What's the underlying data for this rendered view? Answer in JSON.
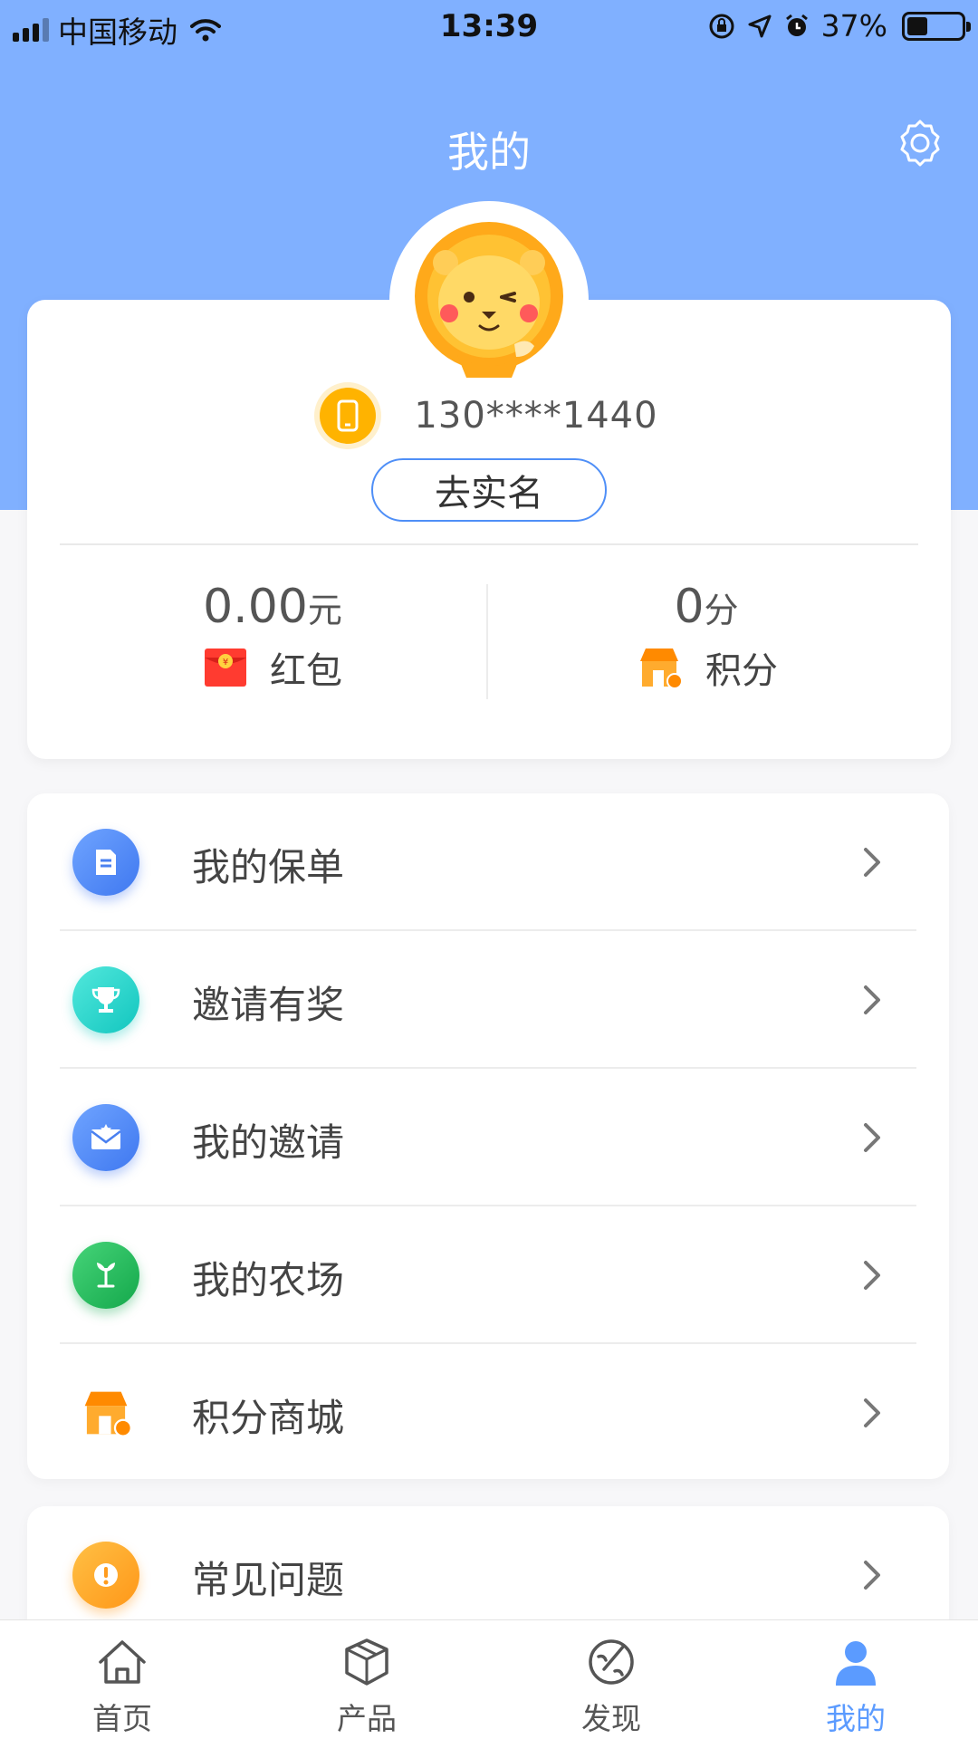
{
  "status_bar": {
    "carrier": "中国移动",
    "time": "13:39",
    "battery": "37%"
  },
  "header": {
    "title": "我的"
  },
  "profile": {
    "phone": "130****1440",
    "realname_button": "去实名",
    "red_packet": {
      "value": "0.00",
      "unit": "元",
      "label": "红包"
    },
    "points": {
      "value": "0",
      "unit": "分",
      "label": "积分"
    }
  },
  "menu": {
    "items": [
      {
        "label": "我的保单",
        "icon": "policy-icon"
      },
      {
        "label": "邀请有奖",
        "icon": "trophy-icon"
      },
      {
        "label": "我的邀请",
        "icon": "invite-icon"
      },
      {
        "label": "我的农场",
        "icon": "farm-icon"
      },
      {
        "label": "积分商城",
        "icon": "store-icon"
      }
    ],
    "extra": [
      {
        "label": "常见问题",
        "icon": "faq-icon"
      }
    ]
  },
  "tab_bar": {
    "tabs": [
      {
        "label": "首页",
        "icon": "home-icon"
      },
      {
        "label": "产品",
        "icon": "box-icon"
      },
      {
        "label": "发现",
        "icon": "discover-icon"
      },
      {
        "label": "我的",
        "icon": "user-icon"
      }
    ],
    "active": "我的",
    "active_color": "#5b9bff"
  },
  "colors": {
    "header_bg": "#80b0ff",
    "accent": "#4f8ff7"
  }
}
